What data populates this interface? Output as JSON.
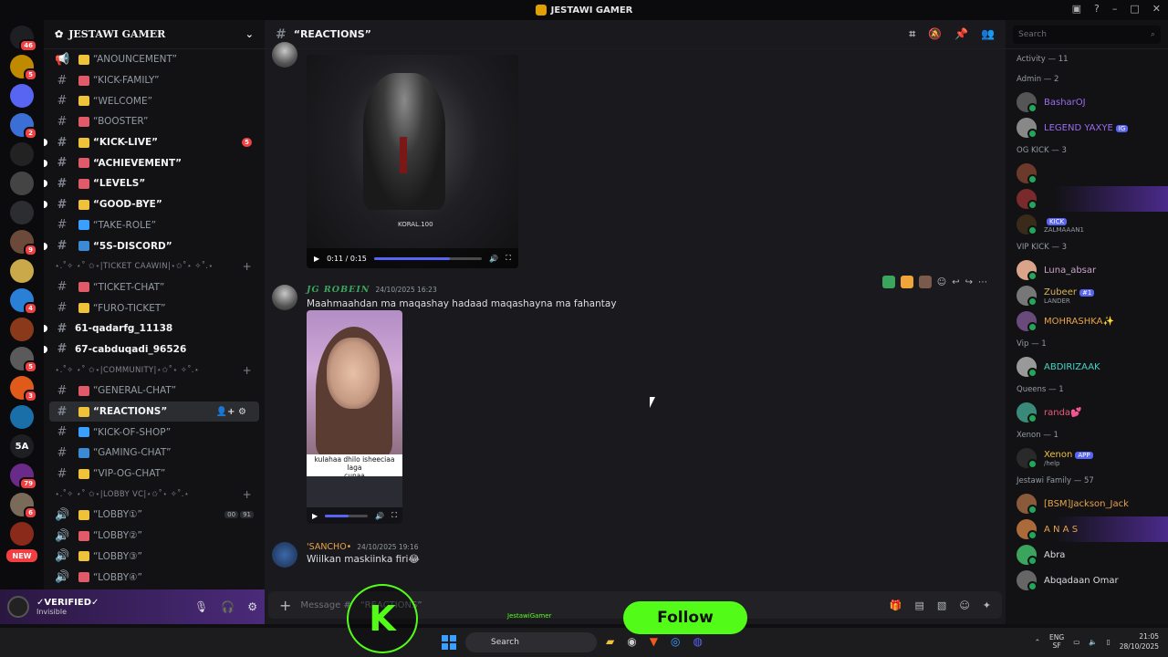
{
  "window": {
    "title": "JESTAWI GAMER"
  },
  "server": {
    "name": "JESTAWI GAMER"
  },
  "guilds": [
    {
      "label": "",
      "badge": "46",
      "color": "#1e1f22"
    },
    {
      "label": "",
      "badge": "5",
      "color": "#c08a00"
    },
    {
      "label": "",
      "badge": "",
      "color": "#5865f2"
    },
    {
      "label": "",
      "badge": "2",
      "color": "#3b6fd6"
    },
    {
      "label": "",
      "badge": "",
      "color": "#222"
    },
    {
      "label": "",
      "badge": "",
      "color": "#444"
    },
    {
      "label": "",
      "badge": "",
      "color": "#2b2d31"
    },
    {
      "label": "",
      "badge": "9",
      "color": "#6b4a3a"
    },
    {
      "label": "",
      "badge": "",
      "color": "#c9a94a"
    },
    {
      "label": "",
      "badge": "4",
      "color": "#2a7fd6"
    },
    {
      "label": "",
      "badge": "",
      "color": "#8a3a1a"
    },
    {
      "label": "",
      "badge": "5",
      "color": "#5a5a5a"
    },
    {
      "label": "",
      "badge": "3",
      "color": "#e05a1a"
    },
    {
      "label": "",
      "badge": "",
      "color": "#1a6fa8"
    },
    {
      "label": "5A",
      "badge": "",
      "color": "#1e1f22"
    },
    {
      "label": "",
      "badge": "79",
      "color": "#6a2a8a"
    },
    {
      "label": "",
      "badge": "6",
      "color": "#7a6a5a"
    },
    {
      "label": "",
      "badge": "",
      "color": "#8a2a1a"
    }
  ],
  "guild_new_label": "NEW",
  "channels": [
    {
      "kind": "chan",
      "label": "“ANOUNCEMENT”",
      "icon": "megaphone-icon",
      "bold": false
    },
    {
      "kind": "chan",
      "label": "“KICK-FAMILY”",
      "bold": false
    },
    {
      "kind": "chan",
      "label": "“WELCOME”",
      "bold": false
    },
    {
      "kind": "chan",
      "label": "“BOOSTER”",
      "bold": false
    },
    {
      "kind": "chan",
      "label": "“KICK-LIVE”",
      "bold": true,
      "count": "5"
    },
    {
      "kind": "chan",
      "label": "“ACHIEVEMENT”",
      "bold": true
    },
    {
      "kind": "chan",
      "label": "“LEVELS”",
      "bold": true
    },
    {
      "kind": "chan",
      "label": "“GOOD-BYE”",
      "bold": true
    },
    {
      "kind": "chan",
      "label": "“TAKE-ROLE”",
      "bold": false
    },
    {
      "kind": "chan",
      "label": "“5S-DISCORD”",
      "bold": true
    },
    {
      "kind": "cat",
      "label": "⋆.˚✧ ⋆˚ ✩⋆|TICKET CAAWIN|⋆✩˚⋆ ✧˚.⋆"
    },
    {
      "kind": "chan",
      "label": "“TICKET-CHAT”",
      "bold": false
    },
    {
      "kind": "chan",
      "label": "“FURO-TICKET”",
      "bold": false
    },
    {
      "kind": "plain",
      "label": "61-qadarfg_11138",
      "bold": true
    },
    {
      "kind": "plain",
      "label": "67-cabduqadi_96526",
      "bold": true
    },
    {
      "kind": "cat",
      "label": "⋆.˚✧ ⋆˚ ✩⋆|COMMUNITY|⋆✩˚⋆ ✧˚.⋆"
    },
    {
      "kind": "chan",
      "label": "“GENERAL-CHAT”",
      "bold": false
    },
    {
      "kind": "chan",
      "label": "“REACTIONS”",
      "bold": true,
      "active": true
    },
    {
      "kind": "chan",
      "label": "“KICK-OF-SHOP”",
      "bold": false
    },
    {
      "kind": "chan",
      "label": "“GAMING-CHAT”",
      "bold": false
    },
    {
      "kind": "chan",
      "label": "“VIP-OG-CHAT”",
      "bold": false
    },
    {
      "kind": "cat",
      "label": "⋆.˚✧ ⋆˚ ✩⋆|LOBBY VC|⋆✩˚⋆ ✧˚.⋆"
    },
    {
      "kind": "voice",
      "label": "“LOBBY①”",
      "vc": [
        "00",
        "91"
      ]
    },
    {
      "kind": "voice",
      "label": "“LOBBY②”"
    },
    {
      "kind": "voice",
      "label": "“LOBBY③”"
    },
    {
      "kind": "voice",
      "label": "“LOBBY④”"
    }
  ],
  "user_panel": {
    "name": "✓VERIFIED✓",
    "status": "Invisible"
  },
  "chat": {
    "channel_title": "“REACTIONS”",
    "video1": {
      "time": "0:11 / 0:15",
      "progress": 0.7,
      "watermark": "KORAL.100"
    },
    "message": {
      "author": "JG ROBEIN",
      "timestamp": "24/10/2025 16:23",
      "text": "Maahmaahdan ma maqashay hadaad maqashayna ma fahantay"
    },
    "video2": {
      "caption": "kulahaa dhilo isheeciaa laga",
      "caption2": "cunaa",
      "progress": 0.55
    },
    "message2": {
      "author": "'SANCHO•",
      "timestamp": "24/10/2025 19:16",
      "text": "Wiilkan maskiinka firi😂"
    },
    "composer_placeholder": "Message #",
    "composer_channel": "“REACTIONS”"
  },
  "members": {
    "search_placeholder": "Search",
    "groups": [
      {
        "title": "Activity — 11",
        "items": []
      },
      {
        "title": "Admin — 2",
        "items": [
          {
            "name": "BasharOJ",
            "color": "#9b6cf2",
            "avatar": "#555"
          },
          {
            "name": "LEGEND YAXYE",
            "color": "#9b6cf2",
            "avatar": "#888",
            "tag": "IG"
          }
        ]
      },
      {
        "title": "OG KICK — 3",
        "items": [
          {
            "name": "",
            "color": "#1a2aa8",
            "avatar": "#6b3a2a"
          },
          {
            "name": "",
            "color": "#1a2aa8",
            "avatar": "#7a2a2a",
            "glow": true
          },
          {
            "name": "",
            "color": "#1a2aa8",
            "avatar": "#3a2a1a",
            "tag": "KICK",
            "sub": "ZALMAAAN1"
          }
        ]
      },
      {
        "title": "VIP KICK — 3",
        "items": [
          {
            "name": "Luna_absar",
            "color": "#c9a3c9",
            "avatar": "#d9a48a"
          },
          {
            "name": "Zubeer",
            "color": "#d9b35a",
            "avatar": "#777",
            "sub": "LANDER",
            "tag": "#1"
          },
          {
            "name": "MOHRASHKA✨",
            "color": "#e6a34a",
            "avatar": "#6a4a7a"
          }
        ]
      },
      {
        "title": "Vip — 1",
        "items": [
          {
            "name": "ABDIRIZAAK",
            "color": "#46d3c6",
            "avatar": "#999"
          }
        ]
      },
      {
        "title": "Queens — 1",
        "items": [
          {
            "name": "randa💕",
            "color": "#e85a7a",
            "avatar": "#3a8a7a"
          }
        ]
      },
      {
        "title": "Xenon — 1",
        "items": [
          {
            "name": "Xenon",
            "color": "#f0c23a",
            "avatar": "#2a2a2a",
            "tag": "APP",
            "sub": "/help"
          }
        ]
      },
      {
        "title": "Jestawi Family — 57",
        "items": [
          {
            "name": "[BSM]Jackson_Jack",
            "color": "#e6a34a",
            "avatar": "#8a5a3a"
          },
          {
            "name": "A N A S",
            "color": "#e6a34a",
            "avatar": "#aa6a3a",
            "glow": true
          },
          {
            "name": "Abra",
            "color": "#dbdee1",
            "avatar": "#3ba55d"
          },
          {
            "name": "Abqadaan Omar",
            "color": "#dbdee1",
            "avatar": "#666"
          }
        ]
      }
    ]
  },
  "overlay": {
    "follow": "Follow",
    "kick_letter": "K",
    "tag": "JestawiGamer"
  },
  "taskbar": {
    "search": "Search",
    "lang": "ENG",
    "lang2": "SF",
    "time": "21:05",
    "date": "28/10/2025"
  }
}
